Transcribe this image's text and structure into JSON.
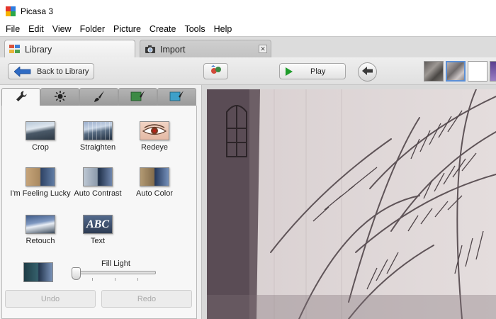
{
  "window": {
    "title": "Picasa 3",
    "logo_colors": [
      "#e4352b",
      "#2e7de1",
      "#f6b400",
      "#2aa84a"
    ]
  },
  "menu": [
    "File",
    "Edit",
    "View",
    "Folder",
    "Picture",
    "Create",
    "Tools",
    "Help"
  ],
  "tabs": [
    {
      "label": "Library",
      "icon": "library-icon",
      "active": true
    },
    {
      "label": "Import",
      "icon": "camera-icon",
      "active": false,
      "close_glyph": "✕"
    }
  ],
  "toolbar": {
    "back_label": "Back to Library",
    "play_label": "Play",
    "share_icon": "share-icon",
    "prev_icon": "left-arrow-icon",
    "accent_play": "#1e9c2a",
    "accent_back": "#2f6bc4"
  },
  "tool_tabs": [
    "wrench-icon",
    "tuning-icon",
    "brush-icon",
    "effects-green-icon",
    "effects-blue-icon"
  ],
  "tools": [
    {
      "label": "Crop",
      "icon": "crop-icon"
    },
    {
      "label": "Straighten",
      "icon": "straighten-icon"
    },
    {
      "label": "Redeye",
      "icon": "redeye-icon"
    },
    {
      "label": "I'm Feeling Lucky",
      "icon": "feeling-lucky-icon"
    },
    {
      "label": "Auto Contrast",
      "icon": "auto-contrast-icon"
    },
    {
      "label": "Auto Color",
      "icon": "auto-color-icon"
    },
    {
      "label": "Retouch",
      "icon": "retouch-icon"
    },
    {
      "label": "Text",
      "icon": "text-icon",
      "glyph": "ABC"
    }
  ],
  "fill_light": {
    "label": "Fill Light",
    "value": 0
  },
  "actions": {
    "undo": "Undo",
    "redo": "Redo"
  }
}
